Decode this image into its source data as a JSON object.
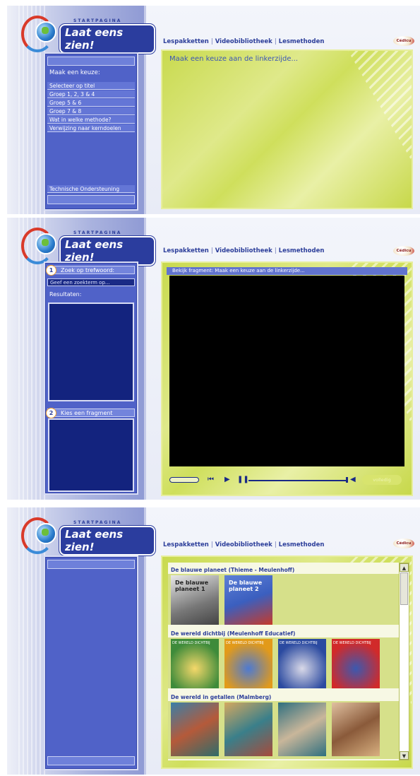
{
  "logo": {
    "small_text": "STARTPAGINA",
    "title": "Laat eens zien!"
  },
  "nav": {
    "items": [
      "Lespakketten",
      "Videobibliotheek",
      "Lesmethoden"
    ],
    "separator": "|"
  },
  "publisher_logo": "Cédicu",
  "panel1": {
    "menu_heading": "Maak een keuze:",
    "menu_items": [
      "Selecteer op titel",
      "Groep 1, 2, 3 & 4",
      "Groep 5 & 6",
      "Groep 7 & 8",
      "Wat in welke methode?",
      "Verwijzing naar kerndoelen"
    ],
    "support": "Technische Ondersteuning",
    "content_text": "Maak een keuze aan de linkerzijde..."
  },
  "panel2": {
    "step1": {
      "number": "1",
      "label": "Zoek op trefwoord:"
    },
    "search": {
      "placeholder": "Geef een zoekterm op..."
    },
    "results_label": "Resultaten:",
    "step2": {
      "number": "2",
      "label": "Kies een fragment"
    },
    "video_header": "Bekijk fragment: Maak een keuze aan de linkerzijde...",
    "fullscreen_label": "volledig"
  },
  "panel3": {
    "sections": [
      {
        "title": "De blauwe planeet (Thieme - Meulenhoff)",
        "books": [
          "De blauwe planeet 1",
          "De blauwe planeet 2"
        ]
      },
      {
        "title": "De wereld dichtbij (Meulenhoff Educatief)",
        "books": [
          "DE WERELD DICHTBIJ",
          "DE WERELD DICHTBIJ",
          "DE WERELD DICHTBIJ",
          "DE WERELD DICHTBIJ"
        ]
      },
      {
        "title": "De wereld in getallen (Malmberg)",
        "books": [
          "",
          "",
          "",
          ""
        ]
      }
    ]
  },
  "colors": {
    "brand_blue": "#2c3e9a",
    "menu_blue": "#5062c8",
    "lime": "#c8d84a"
  }
}
